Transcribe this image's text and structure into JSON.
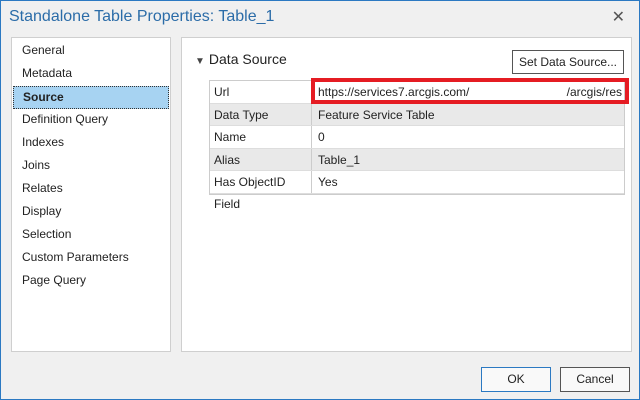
{
  "window": {
    "title": "Standalone Table Properties: Table_1",
    "close_icon": "close-icon"
  },
  "sidebar": {
    "items": [
      {
        "label": "General"
      },
      {
        "label": "Metadata"
      },
      {
        "label": "Source",
        "selected": true
      },
      {
        "label": "Definition Query"
      },
      {
        "label": "Indexes"
      },
      {
        "label": "Joins"
      },
      {
        "label": "Relates"
      },
      {
        "label": "Display"
      },
      {
        "label": "Selection"
      },
      {
        "label": "Custom Parameters"
      },
      {
        "label": "Page Query"
      }
    ]
  },
  "section": {
    "title": "Data Source",
    "set_button": "Set Data Source..."
  },
  "table": {
    "url": {
      "key": "Url",
      "value_start": "https://services7.arcgis.com/",
      "value_end": "/arcgis/res"
    },
    "rows": [
      {
        "key": "Data Type",
        "value": "Feature Service Table"
      },
      {
        "key": "Name",
        "value": "0"
      },
      {
        "key": "Alias",
        "value": "Table_1"
      },
      {
        "key": "Has ObjectID Field",
        "value": "Yes"
      }
    ]
  },
  "buttons": {
    "ok": "OK",
    "cancel": "Cancel"
  },
  "colors": {
    "highlight": "#e51c23",
    "selection": "#a7d3f2",
    "accent": "#2b79c2"
  }
}
